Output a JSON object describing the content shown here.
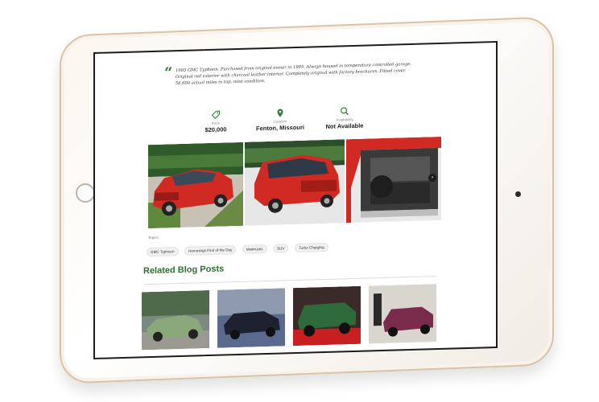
{
  "listing": {
    "quote": "1993 GMC Typhoon. Purchased from original owner in 1995. Always housed in temperature controlled garage. Original red exterior with charcoal leather interior. Completely original with factory brochures. Fitted cover. 56,600 actual miles in top, mint condition.",
    "stats": [
      {
        "icon": "price-tag-icon",
        "label": "Price",
        "value": "$20,000"
      },
      {
        "icon": "location-pin-icon",
        "label": "Location",
        "value": "Fenton, Missouri"
      },
      {
        "icon": "search-icon",
        "label": "Availability",
        "value": "Not Available"
      }
    ]
  },
  "gallery": {
    "next_icon": "chevron-right-icon",
    "next_glyph": "›"
  },
  "topics": {
    "label": "Topics",
    "tags": [
      "GMC Typhoon",
      "Hemmings Find of the Day",
      "Minitrucks",
      "SUV",
      "Turbo Charging"
    ]
  },
  "related": {
    "title": "Related Blog Posts"
  },
  "colors": {
    "accent_green": "#2e7d32",
    "heading_green": "#2e6b2e",
    "truck_red": "#d12a22"
  }
}
